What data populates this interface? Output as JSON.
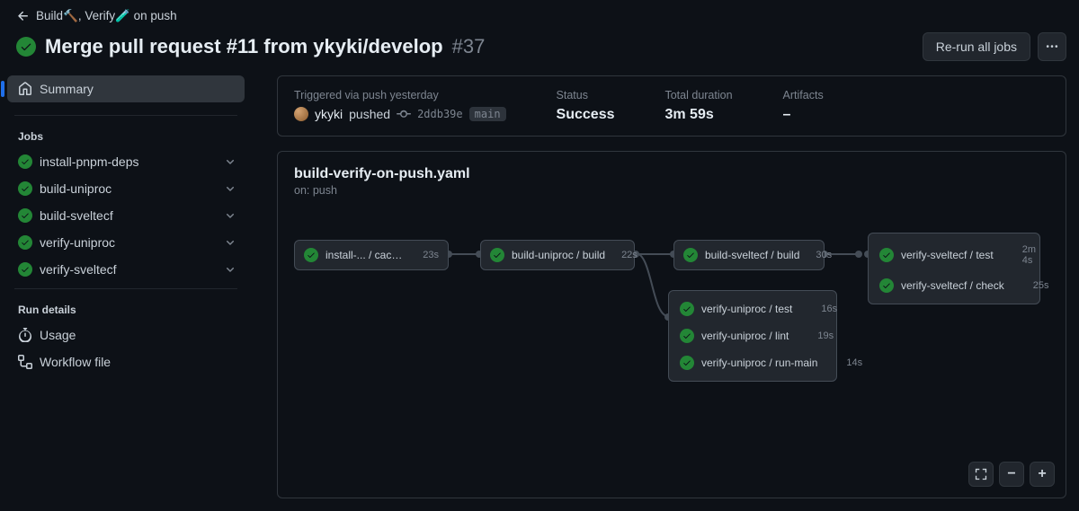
{
  "breadcrumb": {
    "label": "Build🔨, Verify🧪 on push"
  },
  "title": {
    "text": "Merge pull request #11 from ykyki/develop",
    "run_number": "#37"
  },
  "actions": {
    "rerun": "Re-run all jobs"
  },
  "sidebar": {
    "summary": "Summary",
    "jobs_header": "Jobs",
    "jobs": [
      {
        "label": "install-pnpm-deps"
      },
      {
        "label": "build-uniproc"
      },
      {
        "label": "build-sveltecf"
      },
      {
        "label": "verify-uniproc"
      },
      {
        "label": "verify-sveltecf"
      }
    ],
    "run_details_header": "Run details",
    "usage": "Usage",
    "workflow_file": "Workflow file"
  },
  "meta": {
    "triggered_label": "Triggered via push yesterday",
    "actor": "ykyki",
    "pushed": "pushed",
    "commit": "2ddb39e",
    "branch": "main",
    "status_label": "Status",
    "status_value": "Success",
    "duration_label": "Total duration",
    "duration_value": "3m 59s",
    "artifacts_label": "Artifacts",
    "artifacts_value": "–"
  },
  "graph": {
    "title": "build-verify-on-push.yaml",
    "subtitle": "on: push",
    "nodes": {
      "install": {
        "label": "install-... / cache-and-install",
        "time": "23s"
      },
      "build_uniproc": {
        "label": "build-uniproc / build",
        "time": "22s"
      },
      "build_sveltecf": {
        "label": "build-sveltecf / build",
        "time": "30s"
      },
      "verify_uniproc": [
        {
          "label": "verify-uniproc / test",
          "time": "16s"
        },
        {
          "label": "verify-uniproc / lint",
          "time": "19s"
        },
        {
          "label": "verify-uniproc / run-main",
          "time": "14s"
        }
      ],
      "verify_sveltecf": [
        {
          "label": "verify-sveltecf / test",
          "time": "2m 4s"
        },
        {
          "label": "verify-sveltecf / check",
          "time": "25s"
        }
      ]
    }
  }
}
